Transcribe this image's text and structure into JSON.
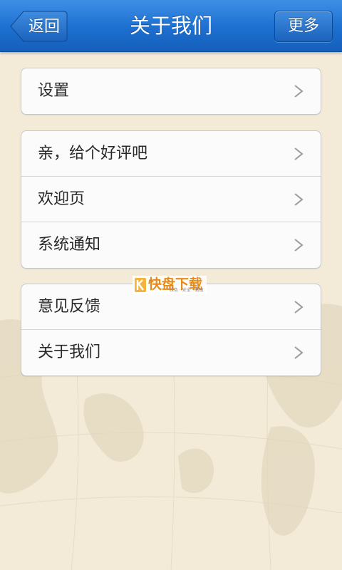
{
  "header": {
    "title": "关于我们",
    "back_label": "返回",
    "more_label": "更多"
  },
  "groups": [
    {
      "items": [
        {
          "label": "设置"
        }
      ]
    },
    {
      "items": [
        {
          "label": "亲，给个好评吧"
        },
        {
          "label": "欢迎页"
        },
        {
          "label": "系统通知"
        }
      ]
    },
    {
      "items": [
        {
          "label": "意见反馈"
        },
        {
          "label": "关于我们"
        }
      ]
    }
  ],
  "watermark": {
    "title": "快盘下载",
    "subtitle": "绿色 · 安全 · 高速"
  },
  "colors": {
    "navbar": "#1d6fd0",
    "background": "#f3ead8",
    "watermark": "#e88a1a"
  }
}
